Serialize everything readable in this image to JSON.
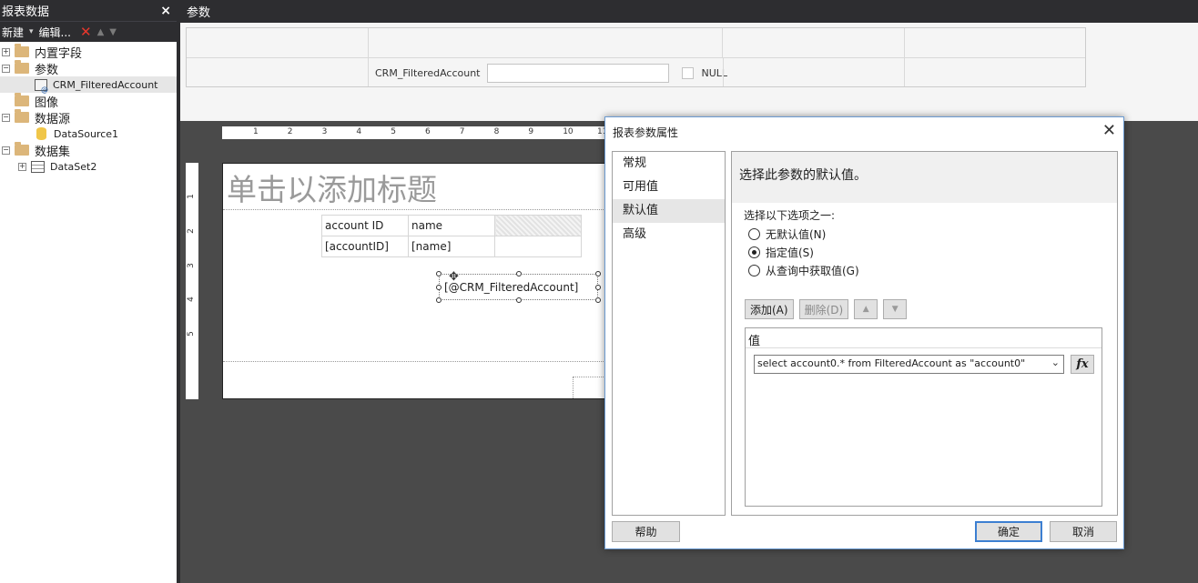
{
  "left_panel": {
    "title": "报表数据",
    "close": "×",
    "toolbar": {
      "new_label": "新建",
      "edit_label": "编辑..."
    },
    "tree": {
      "builtin_fields": "内置字段",
      "parameters": "参数",
      "param_item": "CRM_FilteredAccount",
      "images": "图像",
      "data_sources": "数据源",
      "data_source_item": "DataSource1",
      "datasets": "数据集",
      "dataset_item": "DataSet2"
    }
  },
  "params_pane": {
    "title": "参数",
    "param_label": "CRM_FilteredAccount",
    "param_value": "",
    "null_label": "NULL"
  },
  "design": {
    "ruler_h": [
      "1",
      "2",
      "3",
      "4",
      "5",
      "6",
      "7",
      "8",
      "9",
      "10",
      "11"
    ],
    "ruler_v": [
      "1",
      "2",
      "3",
      "4",
      "5"
    ],
    "title_placeholder": "单击以添加标题",
    "table": {
      "headers": [
        "account ID",
        "name"
      ],
      "row": [
        "[accountID]",
        "[name]"
      ]
    },
    "selected_textbox": "[@CRM_FilteredAccount]"
  },
  "dialog": {
    "title": "报表参数属性",
    "nav": [
      "常规",
      "可用值",
      "默认值",
      "高级"
    ],
    "active_nav": "默认值",
    "heading": "选择此参数的默认值。",
    "choose_label": "选择以下选项之一:",
    "options": [
      "无默认值(N)",
      "指定值(S)",
      "从查询中获取值(G)"
    ],
    "selected_option": "指定值(S)",
    "add_button": "添加(A)",
    "delete_button": "删除(D)",
    "value_header": "值",
    "value": "select  account0.*  from  FilteredAccount as \"account0\"",
    "fx": "fx",
    "help_button": "帮助",
    "ok_button": "确定",
    "cancel_button": "取消"
  }
}
